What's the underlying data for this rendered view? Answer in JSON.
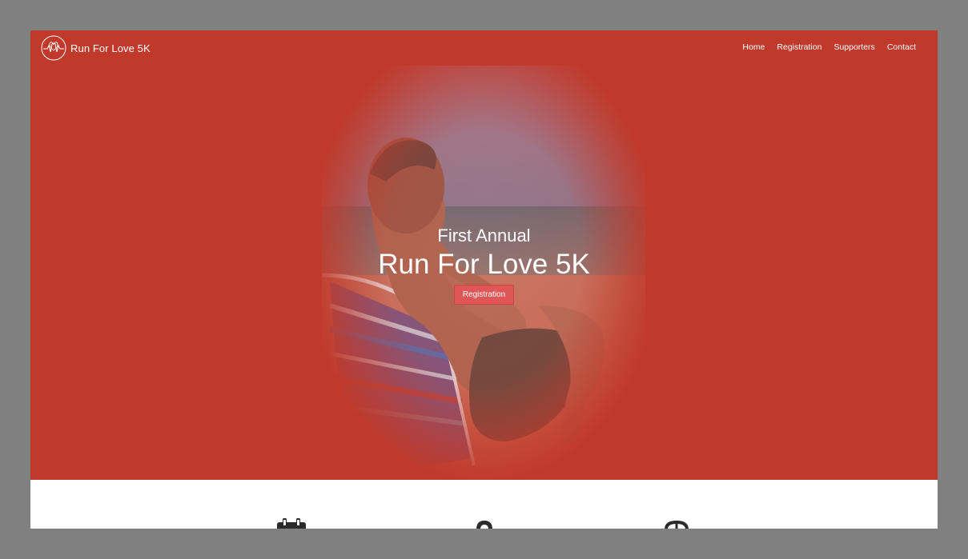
{
  "brand": {
    "name": "Run For Love 5K",
    "logo_icon": "heart-heartbeat-icon"
  },
  "nav": {
    "items": [
      {
        "label": "Home"
      },
      {
        "label": "Registration"
      },
      {
        "label": "Supporters"
      },
      {
        "label": "Contact"
      }
    ]
  },
  "hero": {
    "subtitle": "First Annual",
    "title": "Run For Love 5K",
    "cta_label": "Registration",
    "photo": "man-sitting-in-beach-chair"
  },
  "features": {
    "icons": [
      "calendar-icon",
      "location-pin-icon",
      "clock-icon"
    ]
  },
  "colors": {
    "hero_bg": "#c0392b",
    "cta_bg": "#e05656",
    "frame": "#808080"
  }
}
